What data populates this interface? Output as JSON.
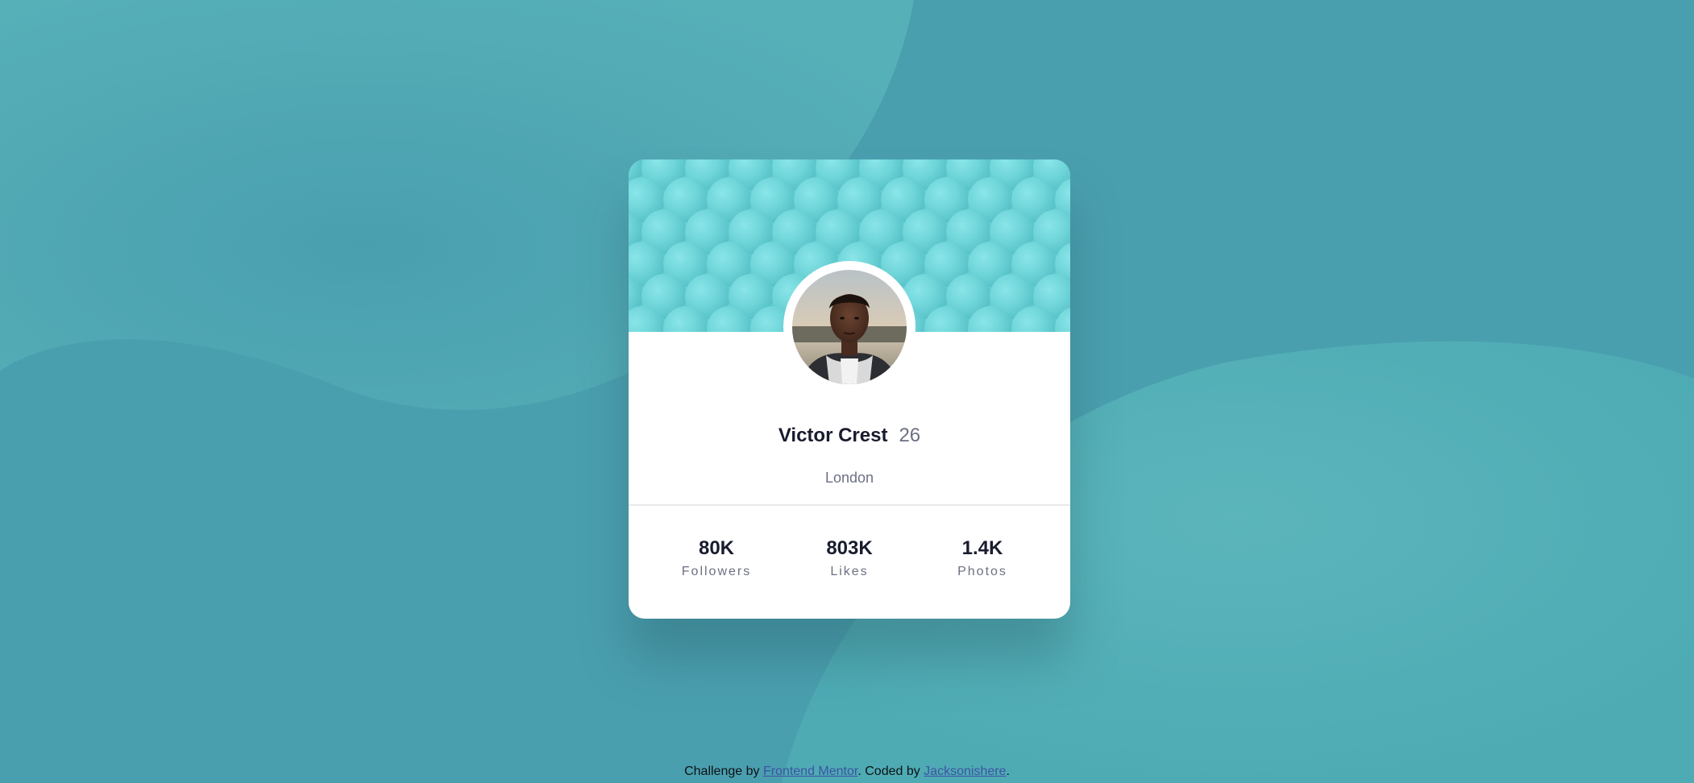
{
  "profile": {
    "name": "Victor Crest",
    "age": "26",
    "city": "London",
    "avatar_alt": "profile-photo"
  },
  "stats": [
    {
      "value": "80K",
      "label": "Followers"
    },
    {
      "value": "803K",
      "label": "Likes"
    },
    {
      "value": "1.4K",
      "label": "Photos"
    }
  ],
  "footer": {
    "prefix": "Challenge by ",
    "link1": "Frontend Mentor",
    "middle": ". Coded by ",
    "link2": "Jacksonishere",
    "suffix": "."
  },
  "colors": {
    "background": "#4aa1ae",
    "header": "#6fd0d6",
    "name_text": "#191c2e",
    "muted_text": "#6b7082",
    "link": "#3e52a3"
  }
}
